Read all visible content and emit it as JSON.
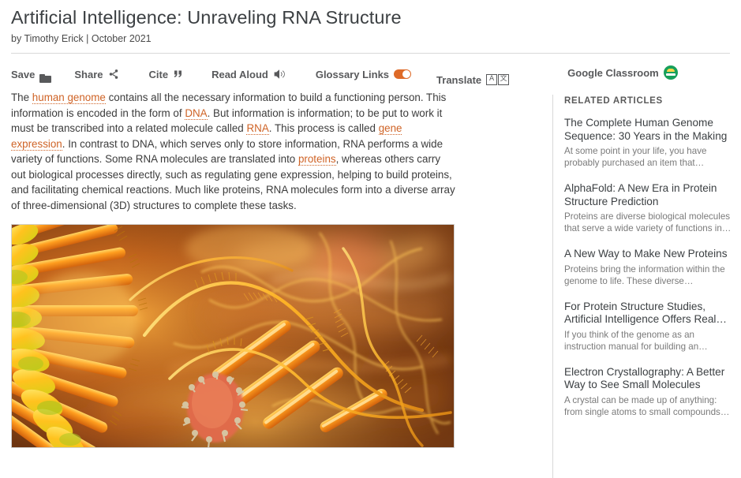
{
  "article": {
    "title": "Artificial Intelligence: Unraveling RNA Structure",
    "byline": "by Timothy Erick | October 2021",
    "paragraph_parts": {
      "p1_a": "The ",
      "p1_link1": "human genome",
      "p1_b": " contains all the necessary information to build a functioning person. This information is encoded in the form of ",
      "p1_link2": "DNA",
      "p1_c": ". But information is information; to be put to work it must be transcribed into a related molecule called ",
      "p1_link3": "RNA",
      "p1_d": ". This process is called ",
      "p1_link4": "gene expression",
      "p1_e": ". In contrast to DNA, which serves only to store information, RNA performs a wide variety of functions. Some RNA molecules are translated into ",
      "p1_link5": "proteins",
      "p1_f": ", whereas others carry out biological processes directly, such as regulating gene expression, helping to build proteins, and facilitating chemical reactions. Much like proteins, RNA molecules form into a diverse array of three-dimensional (3D) structures to complete these tasks."
    },
    "figure_alt": "Artistic 3D rendering of RNA molecules in orange and amber tones"
  },
  "toolbar": {
    "save_label": "Save",
    "save_icon": "folder-icon",
    "share_label": "Share",
    "share_icon": "share-nodes-icon",
    "cite_label": "Cite",
    "cite_icon": "quote-icon",
    "read_aloud_label": "Read Aloud",
    "read_aloud_icon": "speaker-icon",
    "glossary_label": "Glossary Links",
    "glossary_icon": "toggle-on-icon",
    "glossary_state": "on",
    "translate_label": "Translate",
    "translate_icon": "translate-icon",
    "translate_glyph_a": "A",
    "translate_glyph_b": "文",
    "google_classroom_label": "Google Classroom",
    "google_classroom_icon": "google-classroom-icon"
  },
  "sidebar": {
    "heading": "RELATED ARTICLES",
    "items": [
      {
        "title": "The Complete Human Genome Sequence: 30 Years in the Making",
        "snippet": "At some point in your life, you have probably purchased an item that…"
      },
      {
        "title": "AlphaFold: A New Era in Protein Structure Prediction",
        "snippet": "Proteins are diverse biological molecules that serve a wide variety of functions in…"
      },
      {
        "title": "A New Way to Make New Proteins",
        "snippet": "Proteins bring the information within the genome to life. These diverse…"
      },
      {
        "title": "For Protein Structure Studies, Artificial Intelligence Offers Real…",
        "snippet": "If you think of the genome as an instruction manual for building an…"
      },
      {
        "title": "Electron Crystallography: A Better Way to See Small Molecules",
        "snippet": "A crystal can be made up of anything: from single atoms to small compounds…"
      }
    ]
  },
  "colors": {
    "accent_orange": "#cf6326",
    "toggle_orange": "#de6a28",
    "classroom_green": "#17a05a",
    "title_gray": "#3c4043",
    "body_gray": "#3c3c3c",
    "snippet_gray": "#7a7a7a",
    "rule_gray": "#d8d8d8"
  }
}
